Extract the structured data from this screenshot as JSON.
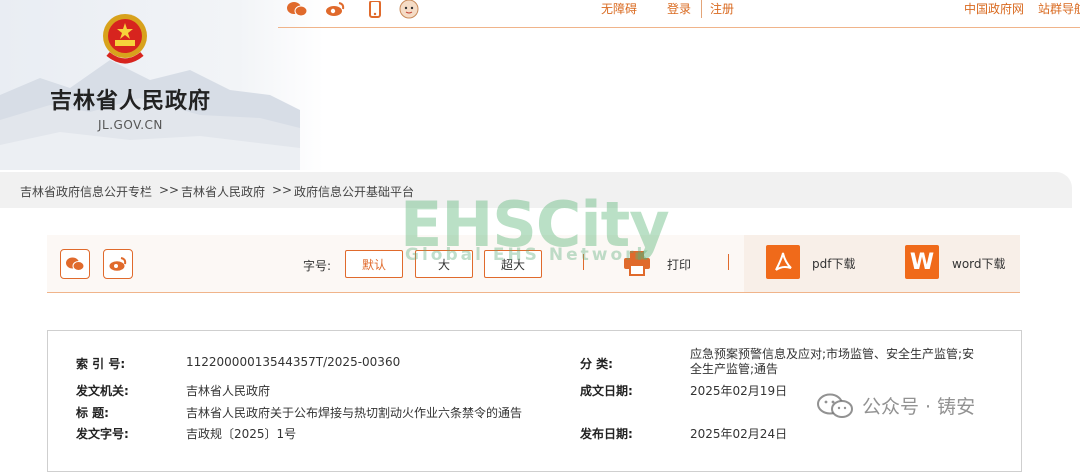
{
  "site": {
    "title": "吉林省人民政府",
    "domain": "JL.GOV.CN"
  },
  "top_bar": {
    "icons": [
      "wechat-icon",
      "weibo-icon",
      "mobile-icon",
      "mascot-icon"
    ],
    "accessibility": "无障碍",
    "login": "登录",
    "register": "注册",
    "gov_cn": "中国政府网",
    "site_group": "站群导航"
  },
  "breadcrumb": {
    "items": [
      "吉林省政府信息公开专栏",
      "吉林省人民政府",
      "政府信息公开基础平台"
    ],
    "separator": ">>"
  },
  "watermark": {
    "brand": "EHSCity",
    "tagline": "Global EHS Network"
  },
  "toolbar": {
    "font_size_label": "字号:",
    "font_sizes": [
      "默认",
      "大",
      "超大"
    ],
    "active_font_size": "默认",
    "print": "打印",
    "pdf_download": "pdf下载",
    "word_download": "word下载",
    "accent_color": "#e06a2c"
  },
  "doc_info": {
    "index_label": "索  引  号:",
    "index_value": "11220000013544357T/2025-00360",
    "category_label": "分    类:",
    "category_value": "应急预案预警信息及应对;市场监管、安全生产监管;安全生产监管;通告",
    "issuer_label": "发文机关:",
    "issuer_value": "吉林省人民政府",
    "written_date_label": "成文日期:",
    "written_date_value": "2025年02月19日",
    "title_label": "标      题:",
    "title_value": "吉林省人民政府关于公布焊接与热切割动火作业六条禁令的通告",
    "doc_no_label": "发文字号:",
    "doc_no_value": "吉政规〔2025〕1号",
    "publish_date_label": "发布日期:",
    "publish_date_value": "2025年02月24日"
  },
  "wechat_account": {
    "text": "公众号 · 铸安"
  }
}
